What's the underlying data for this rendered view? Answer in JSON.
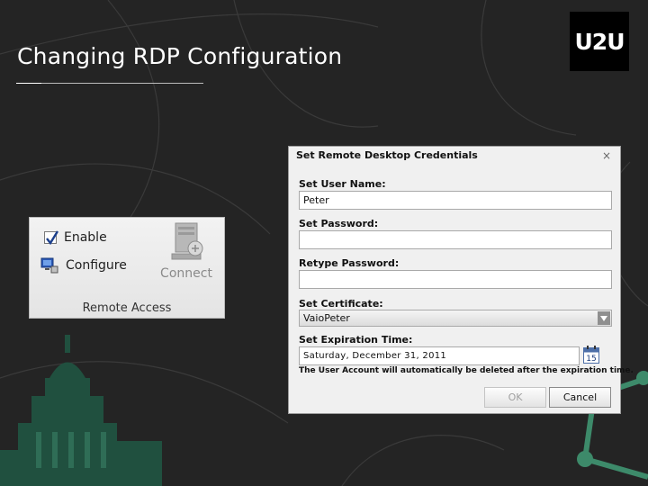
{
  "slide": {
    "title": "Changing RDP Configuration",
    "logo": "U2U"
  },
  "ribbon": {
    "enable_label": "Enable",
    "enable_checked": true,
    "configure_label": "Configure",
    "connect_label": "Connect",
    "group_label": "Remote Access",
    "icons": [
      "checkbox-icon",
      "configure-icon",
      "connect-computer-icon"
    ]
  },
  "dialog": {
    "title": "Set Remote Desktop Credentials",
    "close_glyph": "×",
    "username_label": "Set User Name:",
    "username_value": "Peter",
    "password_label": "Set Password:",
    "password_value": "",
    "retype_label": "Retype Password:",
    "retype_value": "",
    "certificate_label": "Set Certificate:",
    "certificate_value": "VaioPeter",
    "expiration_label": "Set Expiration Time:",
    "expiration_value": "Saturday, December 31, 2011",
    "calendar_day": "15",
    "hint": "The User Account will automatically be deleted after the expiration time.",
    "ok_label": "OK",
    "cancel_label": "Cancel"
  },
  "colors": {
    "background": "#242424",
    "dialog_bg": "#f0f0f0",
    "accent_green": "#3d8a6a",
    "logo_bg": "#000000"
  }
}
